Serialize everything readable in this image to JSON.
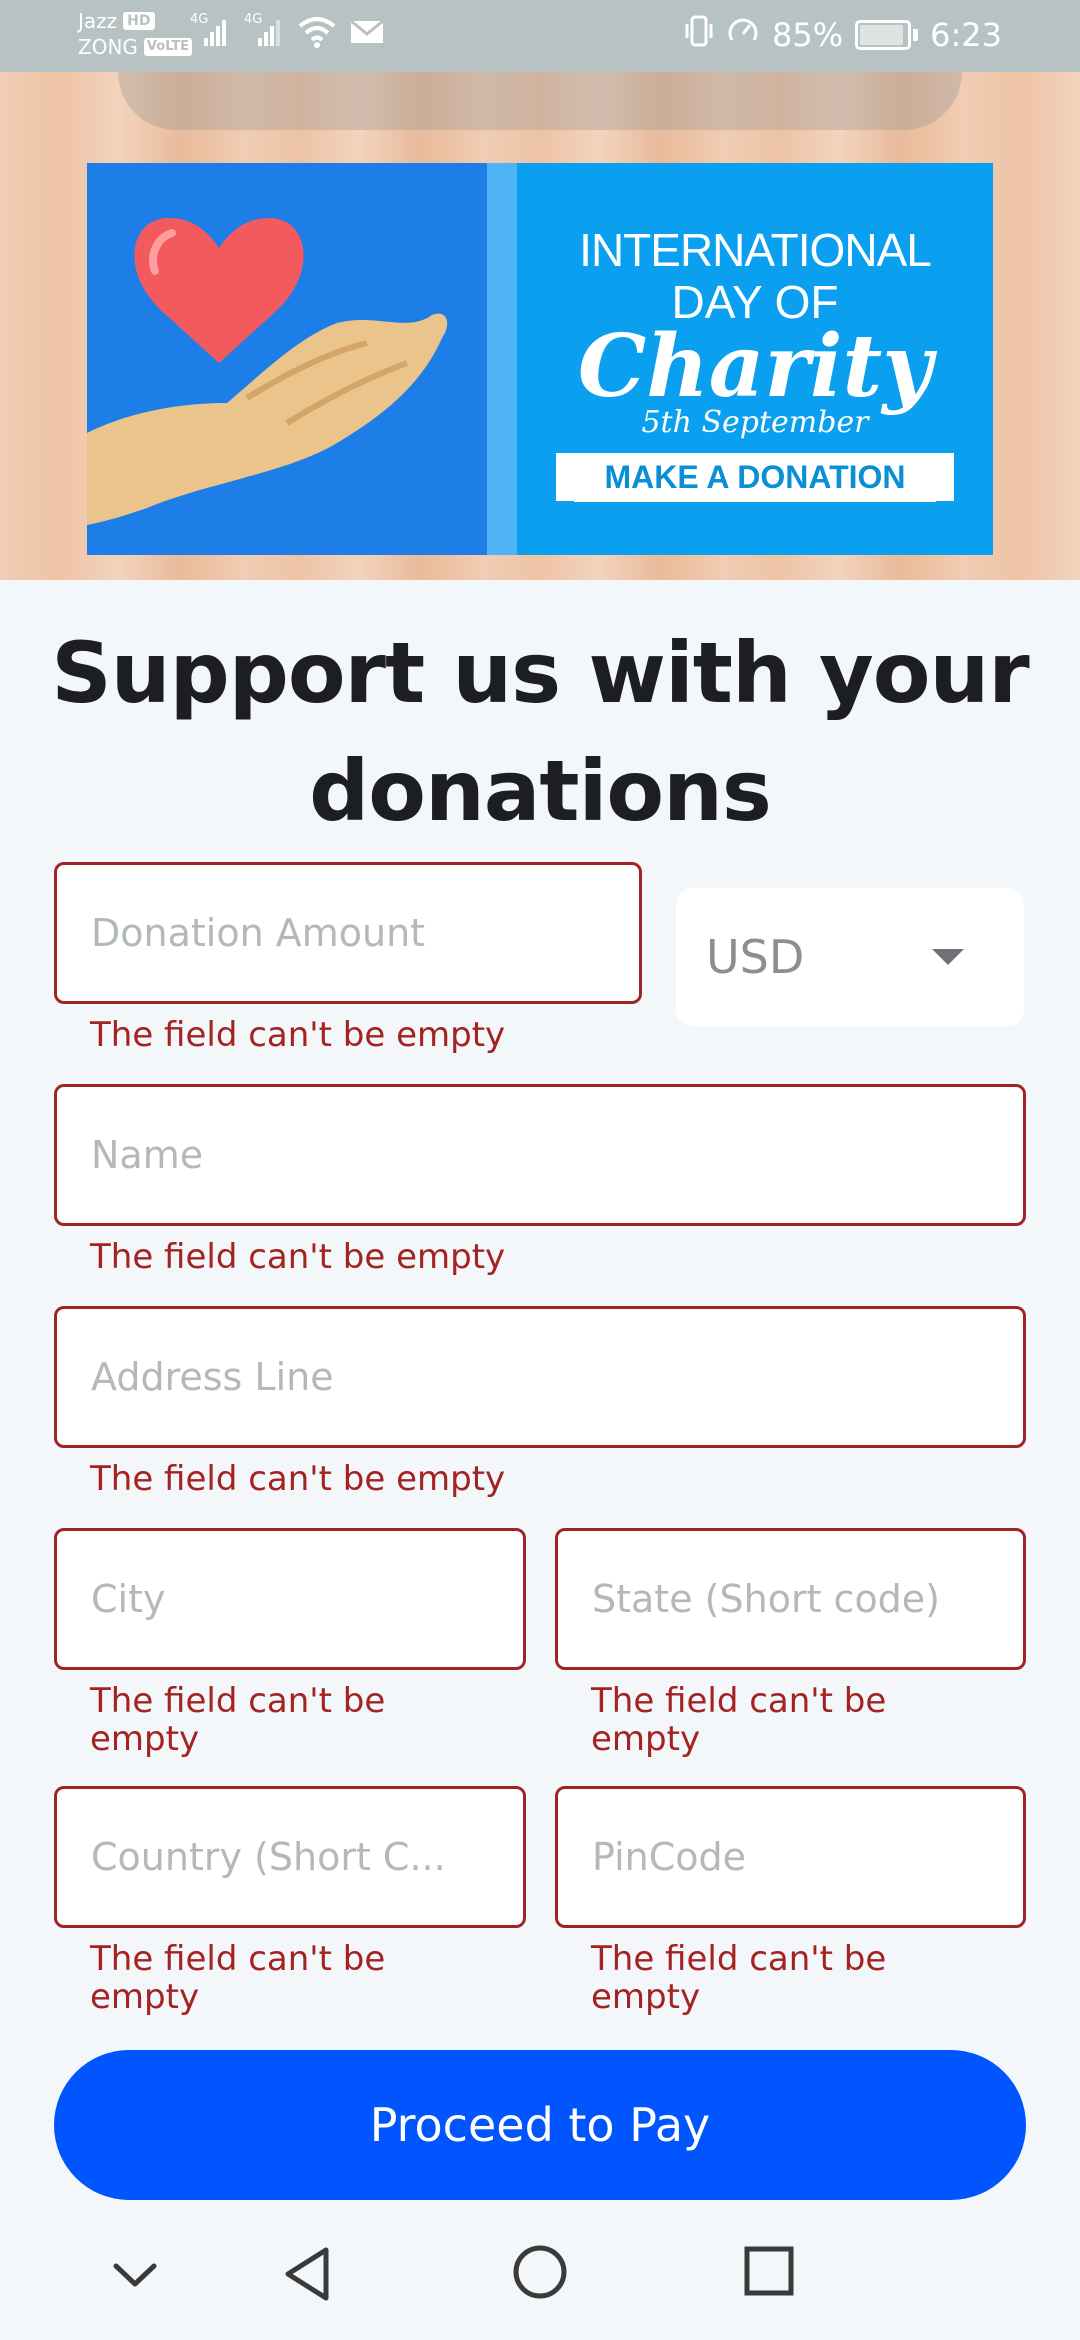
{
  "status_bar": {
    "carrier1": "Jazz",
    "carrier1_badge": "HD",
    "carrier2": "ZONG",
    "carrier2_badge": "VoLTE",
    "network1": "4G",
    "network2": "4G",
    "battery_percent": "85%",
    "time": "6:23",
    "icons": [
      "signal-icon",
      "signal-icon",
      "wifi-icon",
      "mail-icon",
      "vibrate-icon",
      "data-saver-icon",
      "battery-icon"
    ]
  },
  "banner": {
    "line1": "INTERNATIONAL",
    "line2": "DAY OF",
    "line3": "Charity",
    "date": "5th September",
    "ribbon": "MAKE A DONATION",
    "colors": {
      "blue": "#1e7ee8",
      "light_blue": "#0aa0ef",
      "heart": "#f25a5e",
      "hand": "#e8c08a"
    }
  },
  "heading": "Support us with your donations",
  "form": {
    "donation_amount_placeholder": "Donation Amount",
    "currency": "USD",
    "name_placeholder": "Name",
    "address_placeholder": "Address Line",
    "city_placeholder": "City",
    "state_placeholder": "State (Short code)",
    "country_placeholder": "Country (Short C...",
    "pincode_placeholder": "PinCode",
    "error_text": "The field can't be empty"
  },
  "button": {
    "label": "Proceed to Pay",
    "color": "#0055ff"
  },
  "nav_bar": {
    "icons": [
      "chevron-down-icon",
      "back-icon",
      "home-icon",
      "recents-icon"
    ]
  },
  "theme": {
    "error_color": "#a32222",
    "background": "#f4f7f9"
  }
}
